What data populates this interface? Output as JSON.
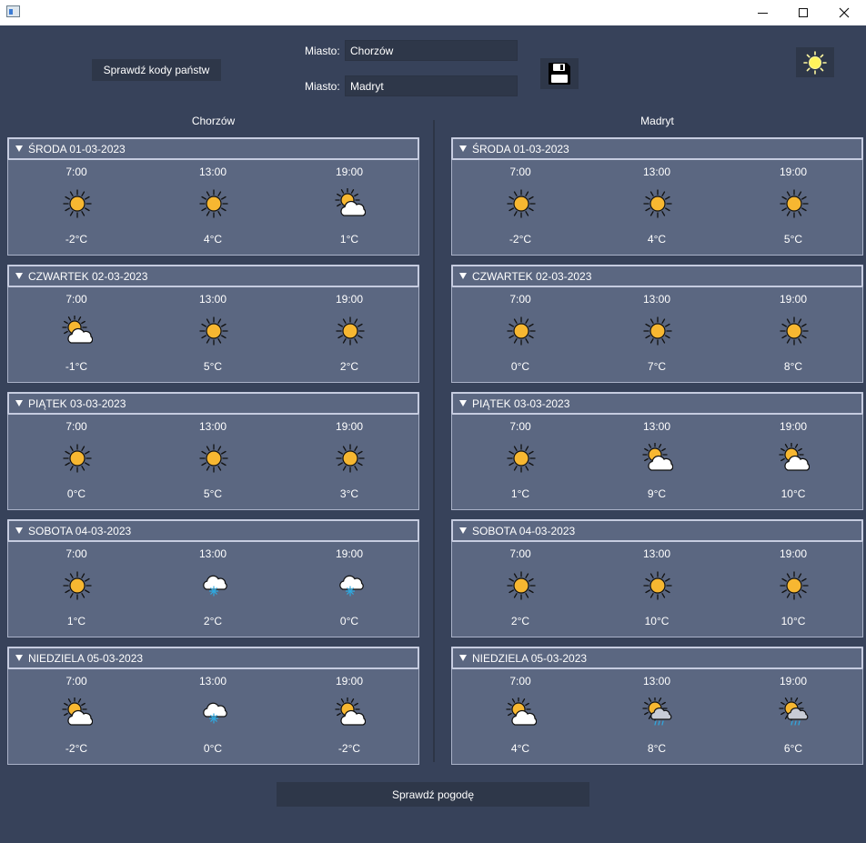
{
  "window": {
    "min_icon": "minimize-icon",
    "max_icon": "maximize-icon",
    "close_icon": "close-icon"
  },
  "top": {
    "check_codes_label": "Sprawdź kody państw",
    "city1_label": "Miasto:",
    "city1_value": "Chorzów",
    "city2_label": "Miasto:",
    "city2_value": "Madryt",
    "save_icon": "floppy-disk-icon",
    "theme_icon": "sun-icon"
  },
  "columns": [
    {
      "title": "Chorzów",
      "days": [
        {
          "title": "ŚRODA 01-03-2023",
          "slots": [
            {
              "time": "7:00",
              "icon": "sun",
              "temp": "-2°C"
            },
            {
              "time": "13:00",
              "icon": "sun",
              "temp": "4°C"
            },
            {
              "time": "19:00",
              "icon": "partly-cloudy",
              "temp": "1°C"
            }
          ]
        },
        {
          "title": "CZWARTEK 02-03-2023",
          "slots": [
            {
              "time": "7:00",
              "icon": "partly-cloudy",
              "temp": "-1°C"
            },
            {
              "time": "13:00",
              "icon": "sun",
              "temp": "5°C"
            },
            {
              "time": "19:00",
              "icon": "sun",
              "temp": "2°C"
            }
          ]
        },
        {
          "title": "PIĄTEK 03-03-2023",
          "slots": [
            {
              "time": "7:00",
              "icon": "sun",
              "temp": "0°C"
            },
            {
              "time": "13:00",
              "icon": "sun",
              "temp": "5°C"
            },
            {
              "time": "19:00",
              "icon": "sun",
              "temp": "3°C"
            }
          ]
        },
        {
          "title": "SOBOTA 04-03-2023",
          "slots": [
            {
              "time": "7:00",
              "icon": "sun",
              "temp": "1°C"
            },
            {
              "time": "13:00",
              "icon": "snow",
              "temp": "2°C"
            },
            {
              "time": "19:00",
              "icon": "snow",
              "temp": "0°C"
            }
          ]
        },
        {
          "title": "NIEDZIELA 05-03-2023",
          "slots": [
            {
              "time": "7:00",
              "icon": "partly-cloudy",
              "temp": "-2°C"
            },
            {
              "time": "13:00",
              "icon": "snow",
              "temp": "0°C"
            },
            {
              "time": "19:00",
              "icon": "partly-cloudy",
              "temp": "-2°C"
            }
          ]
        }
      ]
    },
    {
      "title": "Madryt",
      "days": [
        {
          "title": "ŚRODA 01-03-2023",
          "slots": [
            {
              "time": "7:00",
              "icon": "sun",
              "temp": "-2°C"
            },
            {
              "time": "13:00",
              "icon": "sun",
              "temp": "4°C"
            },
            {
              "time": "19:00",
              "icon": "sun",
              "temp": "5°C"
            }
          ]
        },
        {
          "title": "CZWARTEK 02-03-2023",
          "slots": [
            {
              "time": "7:00",
              "icon": "sun",
              "temp": "0°C"
            },
            {
              "time": "13:00",
              "icon": "sun",
              "temp": "7°C"
            },
            {
              "time": "19:00",
              "icon": "sun",
              "temp": "8°C"
            }
          ]
        },
        {
          "title": "PIĄTEK 03-03-2023",
          "slots": [
            {
              "time": "7:00",
              "icon": "sun",
              "temp": "1°C"
            },
            {
              "time": "13:00",
              "icon": "partly-cloudy",
              "temp": "9°C"
            },
            {
              "time": "19:00",
              "icon": "partly-cloudy",
              "temp": "10°C"
            }
          ]
        },
        {
          "title": "SOBOTA 04-03-2023",
          "slots": [
            {
              "time": "7:00",
              "icon": "sun",
              "temp": "2°C"
            },
            {
              "time": "13:00",
              "icon": "sun",
              "temp": "10°C"
            },
            {
              "time": "19:00",
              "icon": "sun",
              "temp": "10°C"
            }
          ]
        },
        {
          "title": "NIEDZIELA 05-03-2023",
          "slots": [
            {
              "time": "7:00",
              "icon": "partly-cloudy",
              "temp": "4°C"
            },
            {
              "time": "13:00",
              "icon": "sun-rain",
              "temp": "8°C"
            },
            {
              "time": "19:00",
              "icon": "sun-rain",
              "temp": "6°C"
            }
          ]
        }
      ]
    }
  ],
  "bottom": {
    "check_weather_label": "Sprawdź pogodę"
  },
  "colors": {
    "background": "#37425a",
    "panel": "#5b6781",
    "button": "#2e3749",
    "sun": "#f7b731",
    "snow": "#2fa9e0"
  }
}
